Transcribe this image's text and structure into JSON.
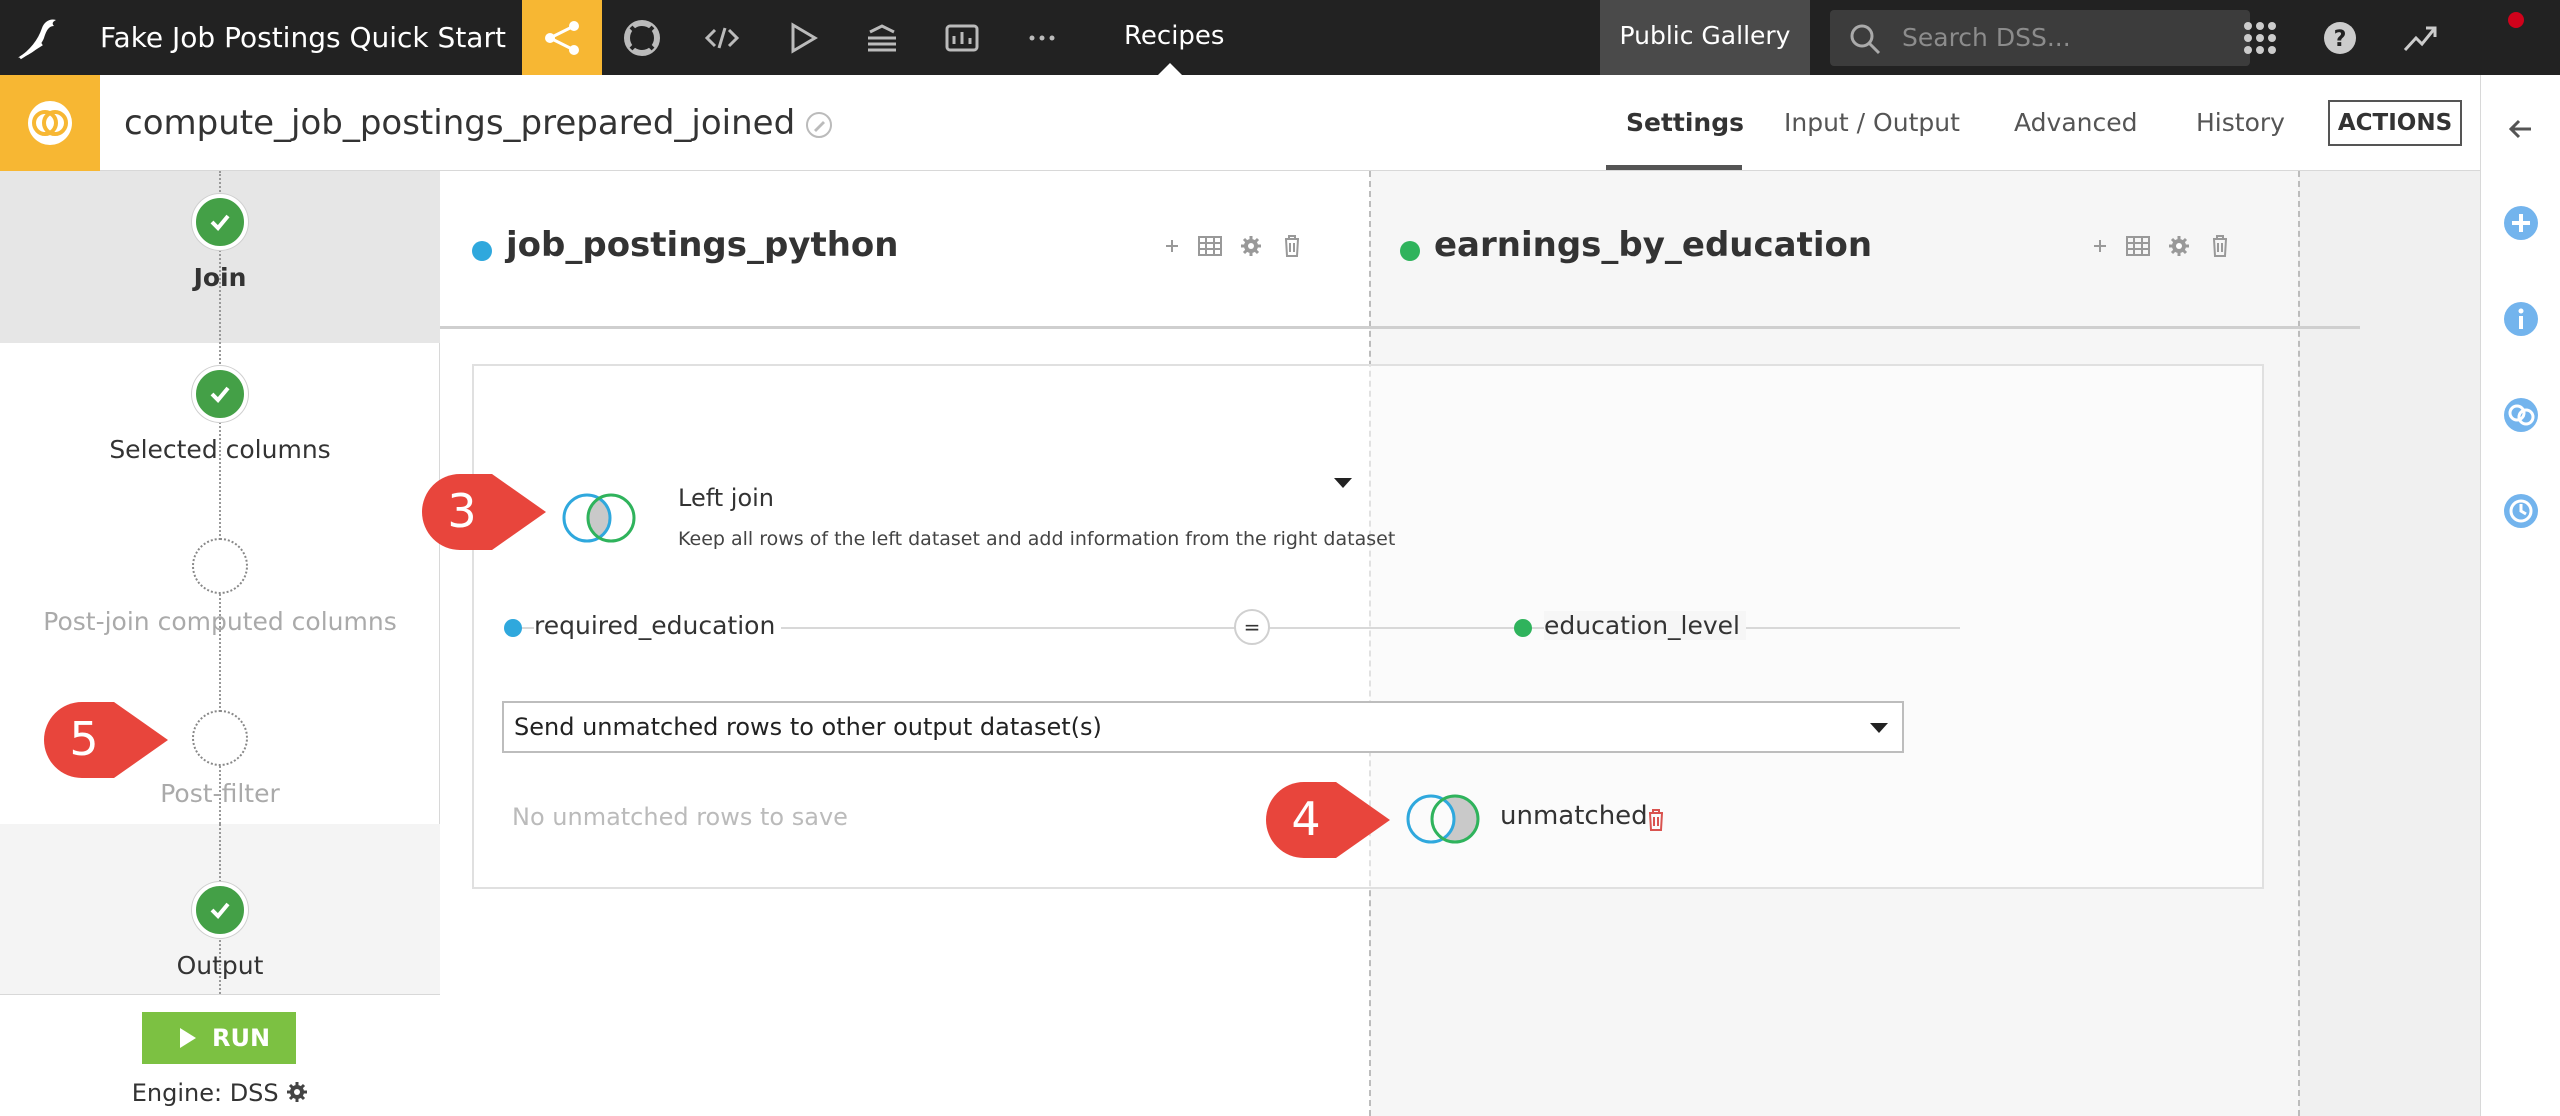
{
  "topbar": {
    "project_title": "Fake Job Postings Quick Start",
    "current_section": "Recipes",
    "gallery_label": "Public Gallery",
    "search_placeholder": "Search DSS...",
    "nav_icons": [
      "flow-icon",
      "lifebuoy-icon",
      "code-icon",
      "run-icon",
      "stack-icon",
      "dashboard-icon",
      "more-icon"
    ],
    "accent_color": "#f7b733"
  },
  "recipe": {
    "name": "compute_job_postings_prepared_joined",
    "tabs": [
      "Settings",
      "Input / Output",
      "Advanced",
      "History"
    ],
    "active_tab": "Settings",
    "actions_label": "ACTIONS"
  },
  "steps": [
    {
      "label": "Join",
      "status": "done"
    },
    {
      "label": "Selected columns",
      "status": "done"
    },
    {
      "label": "Post-join computed columns",
      "status": "empty"
    },
    {
      "label": "Post-filter",
      "status": "empty"
    },
    {
      "label": "Output",
      "status": "done"
    }
  ],
  "run": {
    "label": "RUN",
    "engine_label": "Engine: DSS"
  },
  "datasets": {
    "left": {
      "name": "job_postings_python",
      "color": "#2fa8dd"
    },
    "right": {
      "name": "earnings_by_education",
      "color": "#2fb35c"
    }
  },
  "join": {
    "type_label": "Left join",
    "type_desc": "Keep all rows of the left dataset and add information from the right dataset",
    "condition": {
      "left_column": "required_education",
      "operator": "=",
      "right_column": "education_level"
    },
    "unmatched_option": "Send unmatched rows to other output dataset(s)",
    "no_unmatched_text": "No unmatched rows to save",
    "unmatched_output": "unmatched"
  },
  "callouts": [
    "3",
    "4",
    "5"
  ],
  "colors": {
    "callout_red": "#e8453c",
    "step_green": "#44a047",
    "run_green": "#7cc142",
    "trash_red": "#d9534f",
    "rail_blue": "#5aa7ea"
  }
}
